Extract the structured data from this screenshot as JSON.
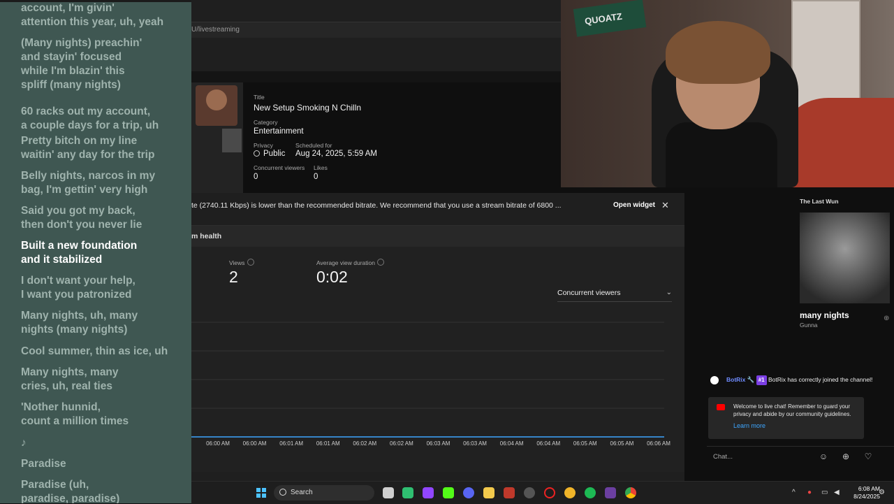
{
  "lyrics": [
    {
      "text": "account, I'm givin'\nattention this year, uh, yeah",
      "active": false
    },
    {
      "text": "(Many nights) preachin'\nand stayin' focused\nwhile I'm blazin' this\nspliff (many nights)",
      "active": false
    },
    {
      "text": "60 racks out my account,\na couple days for a trip, uh",
      "active": false
    },
    {
      "text": "Pretty bitch on my line\nwaitin' any day for the trip",
      "active": false
    },
    {
      "text": "Belly nights, narcos in my\nbag, I'm gettin' very high",
      "active": false
    },
    {
      "text": "Said you got my back,\nthen don't you never lie",
      "active": false
    },
    {
      "text": "Built a new foundation\nand it stabilized",
      "active": true
    },
    {
      "text": "I don't want your help,\nI want you patronized",
      "active": false
    },
    {
      "text": "Many nights, uh, many\nnights (many nights)",
      "active": false
    },
    {
      "text": "Cool summer, thin as ice, uh",
      "active": false
    },
    {
      "text": "Many nights, many\ncries, uh, real ties",
      "active": false
    },
    {
      "text": "'Nother hunnid,\ncount a million times",
      "active": false
    },
    {
      "text": "♪",
      "active": false
    },
    {
      "text": "Paradise",
      "active": false
    },
    {
      "text": "Paradise (uh,\nparadise, paradise)",
      "active": false
    }
  ],
  "studio": {
    "url_fragment": "U/livestreaming",
    "title_label": "Title",
    "title_value": "New Setup Smoking N Chilln",
    "category_label": "Category",
    "category_value": "Entertainment",
    "privacy_label": "Privacy",
    "privacy_value": "Public",
    "scheduled_label": "Scheduled for",
    "scheduled_value": "Aug 24, 2025, 5:59 AM",
    "viewers_label": "Concurrent viewers",
    "viewers_value": "0",
    "likes_label": "Likes",
    "likes_value": "0",
    "warning_text": "te (2740.11 Kbps) is lower than the recommended bitrate. We recommend that you use a stream bitrate of 6800 ...",
    "open_widget_label": "Open widget",
    "health_title": "m health",
    "views_label": "Views",
    "views_value": "2",
    "avg_label": "Average view duration",
    "avg_value": "0:02",
    "dropdown_value": "Concurrent viewers"
  },
  "chart_data": {
    "type": "line",
    "title": "",
    "xlabel": "",
    "ylabel": "",
    "categories": [
      "06:00 AM",
      "06:00 AM",
      "06:01 AM",
      "06:01 AM",
      "06:02 AM",
      "06:02 AM",
      "06:03 AM",
      "06:03 AM",
      "06:04 AM",
      "06:04 AM",
      "06:05 AM",
      "06:05 AM",
      "06:06 AM"
    ],
    "series": [
      {
        "values": [
          0,
          0,
          0,
          0,
          0,
          0,
          0,
          0,
          0,
          0,
          0,
          0,
          0
        ]
      }
    ],
    "ylim": [
      0,
      4
    ],
    "grid": true,
    "line_color": "#3ea6ff"
  },
  "nowplaying": {
    "header": "The Last Wun",
    "song": "many nights",
    "artist": "Gunna"
  },
  "chat": {
    "bot_name": "BotRix",
    "badge": "#1",
    "bot_message": "BotRix has correctly joined the channel!",
    "welcome_text": "Welcome to live chat! Remember to guard your privacy and abide by our community guidelines.",
    "learn_more": "Learn more",
    "input_placeholder": "Chat..."
  },
  "webcam": {
    "flag_text": "QUOATZ"
  },
  "taskbar": {
    "search_placeholder": "Search",
    "time": "6:08 AM",
    "date": "8/24/2025"
  },
  "colors": {
    "lyrics_bg": "#3f5752",
    "accent_blue": "#3ea6ff",
    "badge_purple": "#7b3fe4"
  }
}
